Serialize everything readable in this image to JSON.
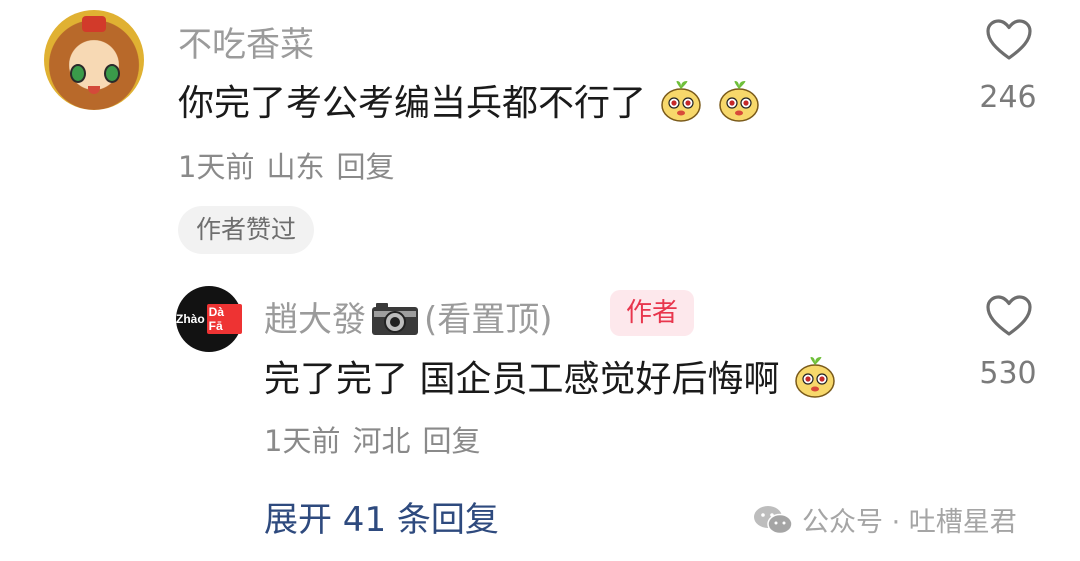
{
  "comment": {
    "username": "不吃香菜",
    "text": "你完了考公考编当兵都不行了",
    "emoji_count": 2,
    "time": "1天前",
    "location": "山东",
    "reply_label": "回复",
    "badge": "作者赞过",
    "likes": "246"
  },
  "reply": {
    "avatar_text_1": "Zhào",
    "avatar_text_2": "Dà Fā",
    "username_prefix": "趙大發",
    "username_suffix": "(看置顶)",
    "author_badge": "作者",
    "text": "完了完了 国企员工感觉好后悔啊",
    "emoji_count": 1,
    "time": "1天前",
    "location": "河北",
    "reply_label": "回复",
    "likes": "530"
  },
  "expand_replies": "展开 41 条回复",
  "watermark": "公众号 · 吐槽星君",
  "icons": [
    "heart-icon",
    "camera-icon",
    "wechat-icon",
    "emoji-icon"
  ],
  "colors": {
    "author_badge_text": "#e8364d",
    "author_badge_bg": "#fde8ec",
    "expand_link": "#2e4a7e",
    "meta_gray": "#8a8a8a"
  }
}
